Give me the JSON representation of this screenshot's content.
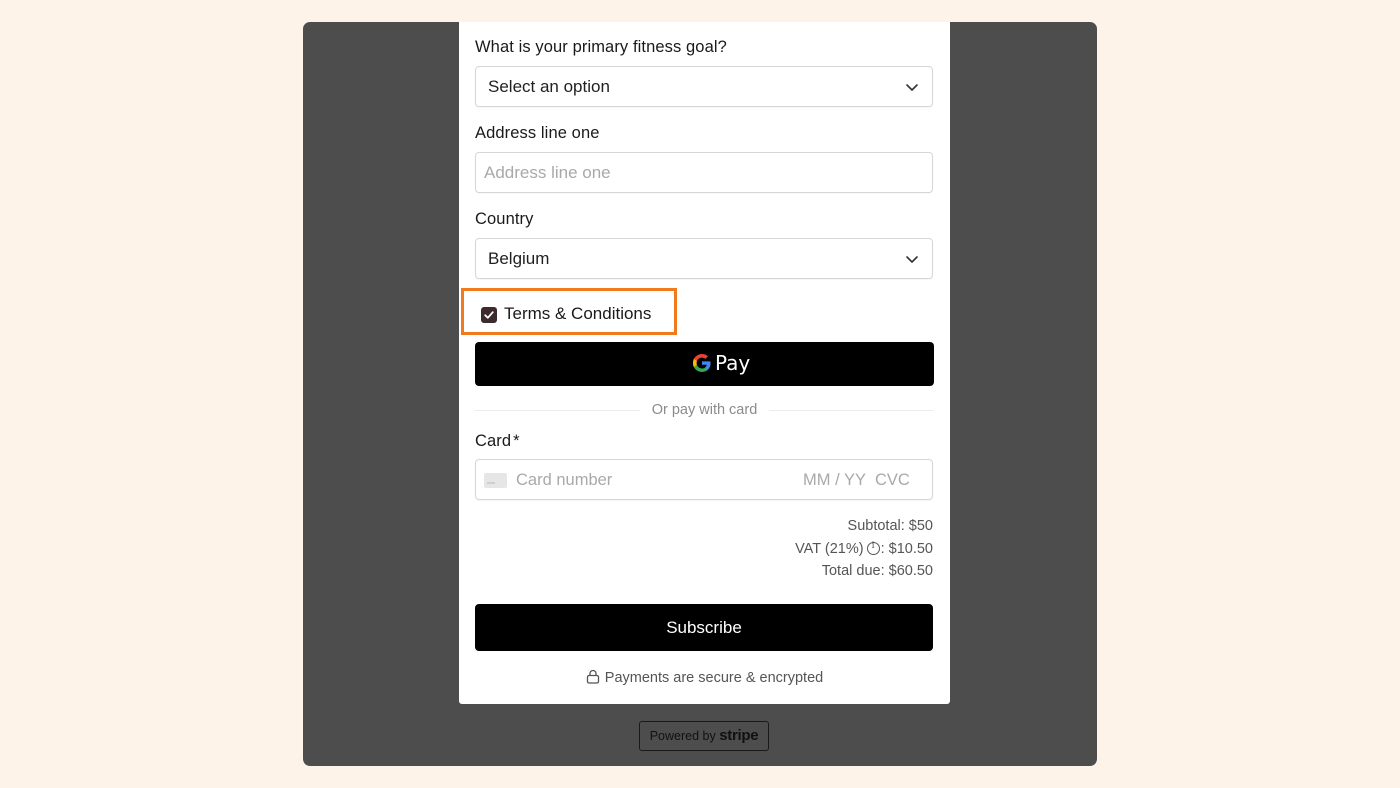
{
  "form": {
    "fitness_goal": {
      "label": "What is your primary fitness goal?",
      "value": "Select an option"
    },
    "address": {
      "label": "Address line one",
      "placeholder": "Address line one"
    },
    "country": {
      "label": "Country",
      "value": "Belgium"
    },
    "terms": {
      "label": "Terms & Conditions",
      "checked": true
    },
    "gpay_label": "Pay",
    "divider_text": "Or pay with card",
    "card": {
      "label": "Card",
      "required_mark": "*",
      "number_placeholder": "Card number",
      "expiry_placeholder": "MM / YY",
      "cvc_placeholder": "CVC"
    }
  },
  "summary": {
    "subtotal": "Subtotal: $50",
    "vat_label": "VAT (21%)",
    "vat_value": ": $10.50",
    "total": "Total due: $60.50"
  },
  "subscribe_label": "Subscribe",
  "secure_text": "Payments are secure & encrypted",
  "powered_by": {
    "prefix": "Powered by",
    "brand": "stripe"
  },
  "colors": {
    "page_background": "#fdf3e9",
    "overlay": "#4d4d4d",
    "highlight": "#f07a1c",
    "checkbox": "#3d2a2f",
    "button": "#000000"
  }
}
